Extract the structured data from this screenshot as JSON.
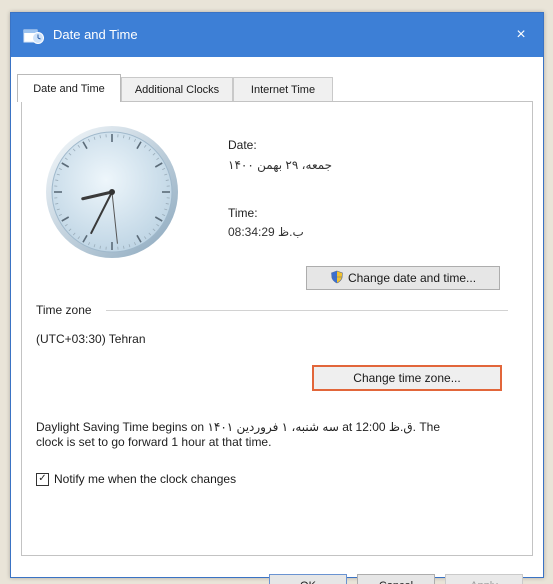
{
  "window": {
    "title": "Date and Time",
    "close_glyph": "×",
    "icon": "date-time-app-icon"
  },
  "tabs": [
    {
      "label": "Date and Time",
      "active": true
    },
    {
      "label": "Additional Clocks",
      "active": false
    },
    {
      "label": "Internet Time",
      "active": false
    }
  ],
  "datetime": {
    "date_label": "Date:",
    "date_value": "جمعه، ۲۹ بهمن ۱۴۰۰",
    "time_label": "Time:",
    "time_value": "08:34:29 ب.ظ",
    "change_button": "Change date and time...",
    "change_button_icon": "uac-shield-icon"
  },
  "clock": {
    "hour": 8,
    "minute": 34,
    "second": 29
  },
  "timezone": {
    "section_label": "Time zone",
    "value": "(UTC+03:30) Tehran",
    "change_button": "Change time zone..."
  },
  "dst": {
    "line1": "Daylight Saving Time begins on سه شنبه، ۱ فروردین ۱۴۰۱ at 12:00 ق.ظ. The",
    "line2": "clock is set to go forward 1 hour at that time."
  },
  "notify": {
    "label": "Notify me when the clock changes",
    "checked": true,
    "check_glyph": "✓"
  },
  "footer": {
    "ok": "OK",
    "cancel": "Cancel",
    "apply": "Apply"
  },
  "colors": {
    "titlebar": "#3d7fd6",
    "highlight": "#e2663a"
  }
}
